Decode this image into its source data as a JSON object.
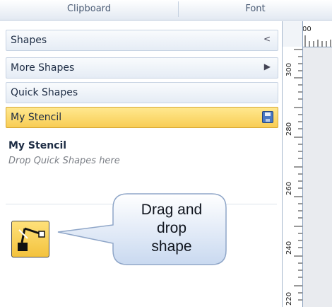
{
  "ribbon": {
    "groups": [
      {
        "label": "Clipboard"
      },
      {
        "label": "Font"
      }
    ]
  },
  "shapes_pane": {
    "header": {
      "label": "Shapes",
      "collapse_glyph": "<"
    },
    "rows": [
      {
        "label": "More Shapes",
        "caret": "▶"
      },
      {
        "label": "Quick Shapes"
      },
      {
        "label": "My Stencil",
        "icon": "save-icon"
      }
    ],
    "stencil": {
      "title": "My Stencil",
      "hint": "Drop Quick Shapes here"
    }
  },
  "callout": {
    "text_lines": [
      "Drag and",
      "drop",
      "shape"
    ]
  },
  "ruler": {
    "top_label": "00",
    "side_labels": [
      "300",
      "280",
      "260",
      "240",
      "220"
    ]
  },
  "colors": {
    "active_row": "#f8cd55",
    "callout_fill": "#dfe9f8",
    "pane_border": "#a7b7cc"
  }
}
